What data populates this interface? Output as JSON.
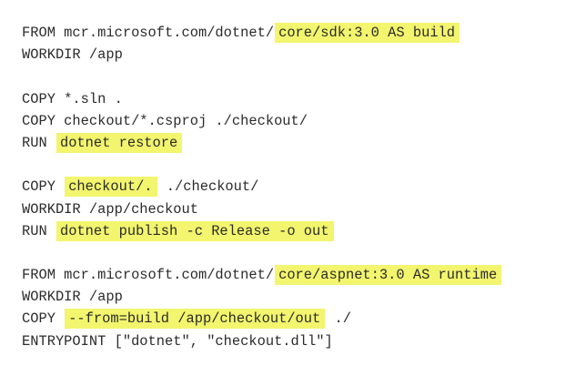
{
  "dockerfile": {
    "highlight_color": "#f2f56d",
    "lines": [
      {
        "pre": "FROM mcr.microsoft.com/dotnet/",
        "hl": "core/sdk:3.0 AS build",
        "post": ""
      },
      {
        "pre": "WORKDIR /app",
        "hl": "",
        "post": ""
      },
      {
        "pre": "",
        "hl": "",
        "post": ""
      },
      {
        "pre": "COPY *.sln .",
        "hl": "",
        "post": ""
      },
      {
        "pre": "COPY checkout/*.csproj ./checkout/",
        "hl": "",
        "post": ""
      },
      {
        "pre": "RUN ",
        "hl": "dotnet restore",
        "post": ""
      },
      {
        "pre": "",
        "hl": "",
        "post": ""
      },
      {
        "pre": "COPY ",
        "hl": "checkout/.",
        "post": " ./checkout/"
      },
      {
        "pre": "WORKDIR /app/checkout",
        "hl": "",
        "post": ""
      },
      {
        "pre": "RUN ",
        "hl": "dotnet publish -c Release -o out",
        "post": ""
      },
      {
        "pre": "",
        "hl": "",
        "post": ""
      },
      {
        "pre": "FROM mcr.microsoft.com/dotnet/",
        "hl": "core/aspnet:3.0 AS runtime",
        "post": ""
      },
      {
        "pre": "WORKDIR /app",
        "hl": "",
        "post": ""
      },
      {
        "pre": "COPY ",
        "hl": "--from=build /app/checkout/out",
        "post": " ./"
      },
      {
        "pre": "ENTRYPOINT [\"dotnet\", \"checkout.dll\"]",
        "hl": "",
        "post": ""
      }
    ]
  }
}
